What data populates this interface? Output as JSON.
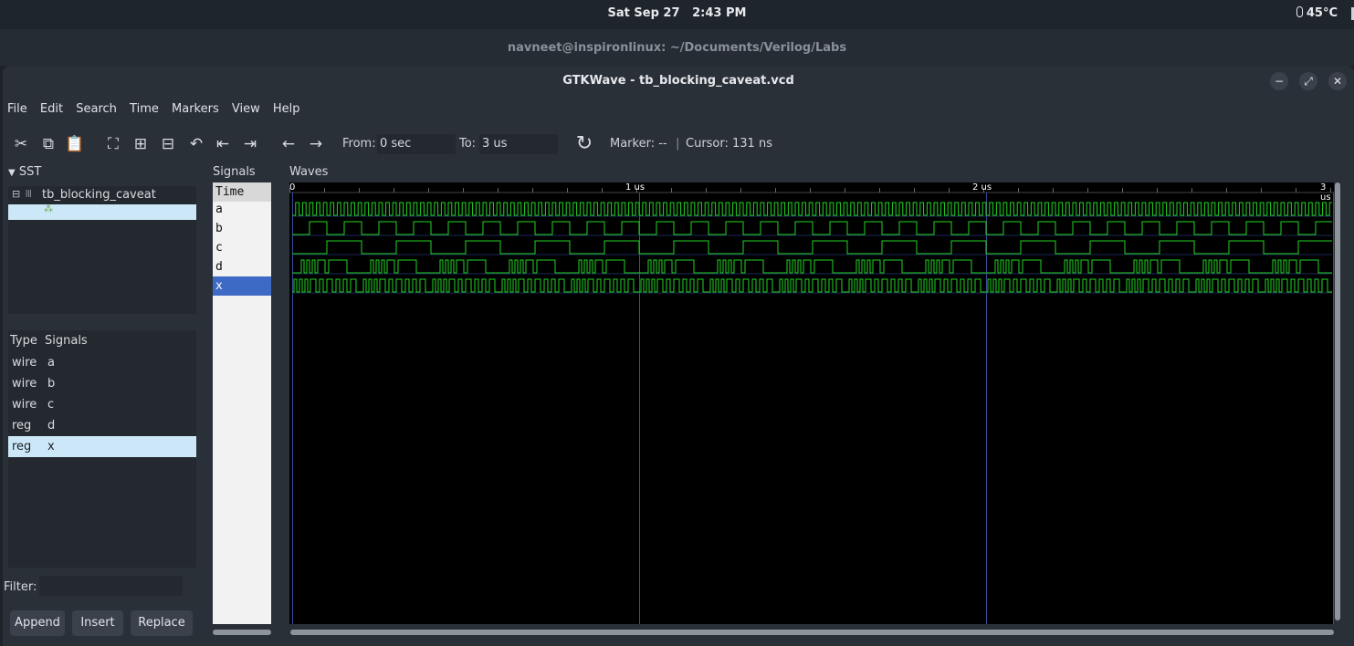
{
  "system": {
    "date": "Sat Sep 27",
    "time": "2:43 PM",
    "temperature": "45°C"
  },
  "terminal_title": "navneet@inspironlinux: ~/Documents/Verilog/Labs",
  "window": {
    "title": "GTKWave - tb_blocking_caveat.vcd",
    "buttons": [
      "minimize",
      "maximize",
      "close"
    ]
  },
  "menu": [
    "File",
    "Edit",
    "Search",
    "Time",
    "Markers",
    "View",
    "Help"
  ],
  "toolbar": {
    "from_label": "From:",
    "from_value": "0 sec",
    "to_label": "To:",
    "to_value": "3 us",
    "marker": "Marker: --",
    "cursor": "Cursor: 131 ns"
  },
  "sst": {
    "title": "SST",
    "tree": [
      {
        "label": "tb_blocking_caveat"
      },
      {
        "label": ""
      }
    ],
    "list_headers": {
      "type": "Type",
      "signals": "Signals"
    },
    "signals": [
      {
        "type": "wire",
        "name": "a"
      },
      {
        "type": "wire",
        "name": "b"
      },
      {
        "type": "wire",
        "name": "c"
      },
      {
        "type": "reg",
        "name": "d"
      },
      {
        "type": "reg",
        "name": "x"
      }
    ],
    "filter_label": "Filter:",
    "filter_value": "",
    "buttons": [
      "Append",
      "Insert",
      "Replace"
    ]
  },
  "signals_panel": {
    "title": "Signals",
    "rows": [
      "Time",
      "a",
      "b",
      "c",
      "d",
      "x"
    ],
    "selected": "x"
  },
  "waves_panel": {
    "title": "Waves",
    "ticks": [
      "0",
      "1 us",
      "2 us",
      "3 us"
    ],
    "wave_color": "#22d422",
    "grid_color": "#3a4a9a"
  }
}
